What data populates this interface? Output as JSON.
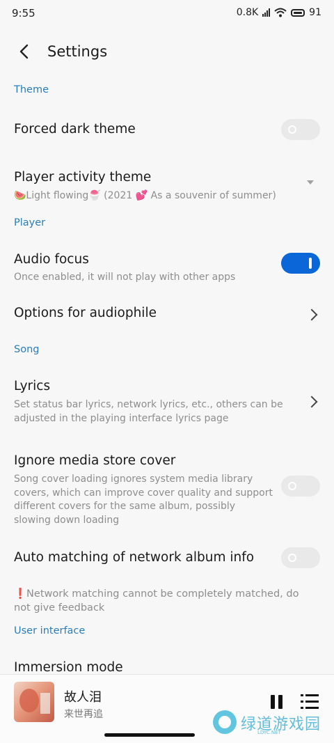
{
  "status_bar": {
    "time": "9:55",
    "net_speed": "0.8K",
    "battery": "91"
  },
  "header": {
    "title": "Settings"
  },
  "sections": {
    "theme": "Theme",
    "player": "Player",
    "song": "Song",
    "ui": "User interface"
  },
  "settings": {
    "forced_dark": {
      "title": "Forced dark theme",
      "enabled": false
    },
    "player_theme": {
      "title": "Player activity theme",
      "value": "🍉Light flowing🍧 (2021 💕 As a souvenir of summer)"
    },
    "audio_focus": {
      "title": "Audio focus",
      "subtitle": "Once enabled, it will not play with other apps",
      "enabled": true
    },
    "audiophile": {
      "title": "Options for audiophile"
    },
    "lyrics": {
      "title": "Lyrics",
      "sub1": "Set status bar lyrics, network lyrics, etc., others can be",
      "sub2": "adjusted in the playing interface lyrics page"
    },
    "ignore_cover": {
      "title": "Ignore media store cover",
      "sub1": "Song cover loading ignores system media library",
      "sub2": "covers, which can improve cover quality and support",
      "sub3": "different covers for the same album, possibly",
      "sub4": "slowing down loading",
      "enabled": false
    },
    "auto_match": {
      "title": "Auto matching of network album info",
      "note1": "❗Network matching cannot be completely matched, do",
      "note2": "not give feedback",
      "enabled": false
    },
    "immersion": {
      "title": "Immersion mode"
    }
  },
  "player": {
    "song": "故人泪",
    "artist": "来世再追"
  },
  "watermark": {
    "text": "绿道游戏园",
    "url": "LDYC.NET"
  },
  "colors": {
    "accent": "#0b67d8",
    "section": "#2a7db8"
  }
}
